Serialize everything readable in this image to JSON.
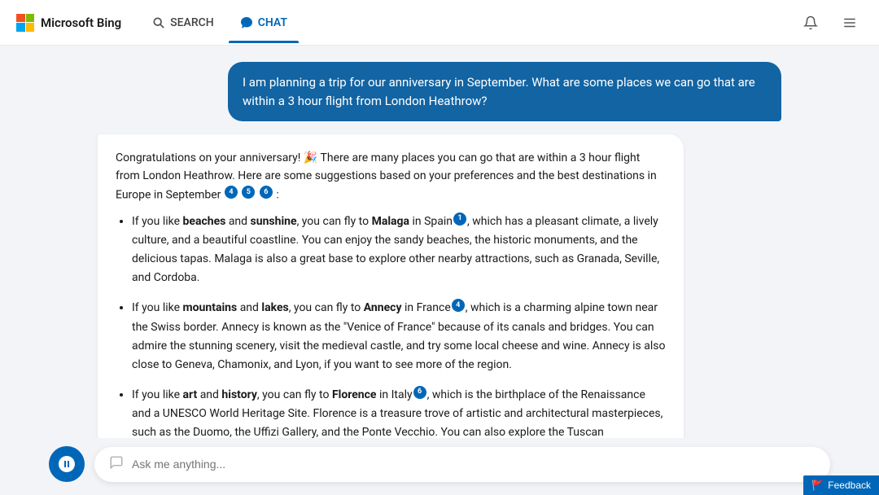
{
  "header": {
    "logo_text": "Microsoft Bing",
    "nav_search_label": "SEARCH",
    "nav_chat_label": "CHAT",
    "notification_icon": "🔔",
    "menu_icon": "☰"
  },
  "user_message": {
    "text": "I am planning a trip for our anniversary in September. What are some places we can go that are within a 3 hour flight from London Heathrow?"
  },
  "bot_message": {
    "intro": "Congratulations on your anniversary! 🎉 There are many places you can go that are within a 3 hour flight from London Heathrow. Here are some suggestions based on your preferences and the best destinations in Europe in September",
    "intro_cites": [
      "4",
      "5",
      "6"
    ],
    "items": [
      {
        "prefix": "If you like ",
        "bold1": "beaches",
        "mid1": " and ",
        "bold2": "sunshine",
        "mid2": ", you can fly to ",
        "bold3": "Malaga",
        "mid3": " in Spain",
        "cite": "1",
        "rest": ", which has a pleasant climate, a lively culture, and a beautiful coastline. You can enjoy the sandy beaches, the historic monuments, and the delicious tapas. Malaga is also a great base to explore other nearby attractions, such as Granada, Seville, and Cordoba."
      },
      {
        "prefix": "If you like ",
        "bold1": "mountains",
        "mid1": " and ",
        "bold2": "lakes",
        "mid2": ", you can fly to ",
        "bold3": "Annecy",
        "mid3": " in France",
        "cite": "4",
        "rest": ", which is a charming alpine town near the Swiss border. Annecy is known as the \"Venice of France\" because of its canals and bridges. You can admire the stunning scenery, visit the medieval castle, and try some local cheese and wine. Annecy is also close to Geneva, Chamonix, and Lyon, if you want to see more of the region."
      },
      {
        "prefix": "If you like ",
        "bold1": "art",
        "mid1": " and ",
        "bold2": "history",
        "mid2": ", you can fly to ",
        "bold3": "Florence",
        "mid3": " in Italy",
        "cite": "6",
        "rest": ", which is the birthplace of the Renaissance and a UNESCO World Heritage Site. Florence is a treasure trove of artistic and architectural masterpieces, such as the Duomo, the Uffizi Gallery, and the Ponte Vecchio. You can also explore the Tuscan countryside, taste the famous gelato, and shop for leather goods."
      }
    ]
  },
  "input": {
    "placeholder": "Ask me anything..."
  },
  "feedback": {
    "label": "Feedback",
    "icon": "🚩"
  }
}
